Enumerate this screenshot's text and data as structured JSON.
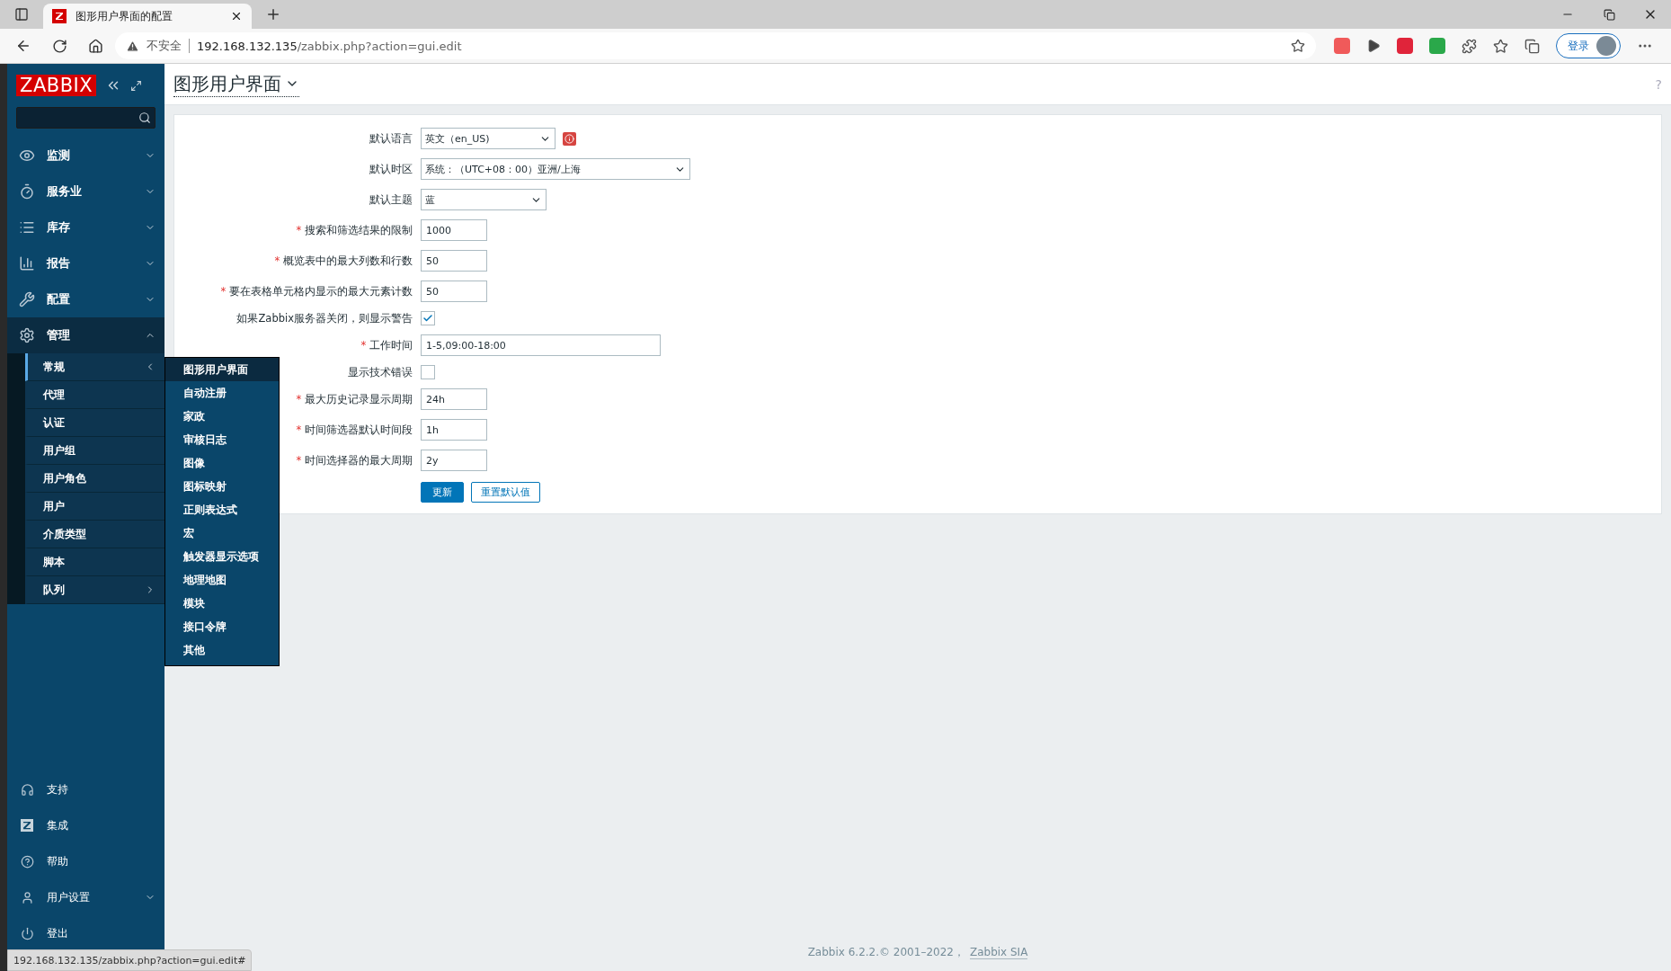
{
  "browser": {
    "tab_title": "图形用户界面的配置",
    "security": "不安全",
    "url_host": "192.168.132.135",
    "url_path": "/zabbix.php?action=gui.edit",
    "login": "登录"
  },
  "sidebar": {
    "logo": "ZABBIX",
    "items": [
      {
        "label": "监测",
        "expanded": false
      },
      {
        "label": "服务业",
        "expanded": false
      },
      {
        "label": "库存",
        "expanded": false
      },
      {
        "label": "报告",
        "expanded": false
      },
      {
        "label": "配置",
        "expanded": false
      },
      {
        "label": "管理",
        "expanded": true,
        "children": [
          {
            "label": "常规",
            "selected": true,
            "submenu": true
          },
          {
            "label": "代理",
            "selected": false,
            "submenu": false
          },
          {
            "label": "认证",
            "selected": false,
            "submenu": false
          },
          {
            "label": "用户组",
            "selected": false,
            "submenu": false
          },
          {
            "label": "用户角色",
            "selected": false,
            "submenu": false
          },
          {
            "label": "用户",
            "selected": false,
            "submenu": false
          },
          {
            "label": "介质类型",
            "selected": false,
            "submenu": false
          },
          {
            "label": "脚本",
            "selected": false,
            "submenu": false
          },
          {
            "label": "队列",
            "selected": false,
            "submenu": true
          }
        ]
      }
    ],
    "bottom_items": [
      {
        "label": "支持"
      },
      {
        "label": "集成"
      },
      {
        "label": "帮助"
      },
      {
        "label": "用户设置",
        "expanded": false
      },
      {
        "label": "登出"
      }
    ]
  },
  "flyout": [
    {
      "label": "图形用户界面",
      "selected": true
    },
    {
      "label": "自动注册",
      "selected": false
    },
    {
      "label": "家政",
      "selected": false
    },
    {
      "label": "审核日志",
      "selected": false
    },
    {
      "label": "图像",
      "selected": false
    },
    {
      "label": "图标映射",
      "selected": false
    },
    {
      "label": "正则表达式",
      "selected": false
    },
    {
      "label": "宏",
      "selected": false
    },
    {
      "label": "触发器显示选项",
      "selected": false
    },
    {
      "label": "地理地图",
      "selected": false
    },
    {
      "label": "模块",
      "selected": false
    },
    {
      "label": "接口令牌",
      "selected": false
    },
    {
      "label": "其他",
      "selected": false
    }
  ],
  "page": {
    "title": "图形用户界面",
    "help": "?"
  },
  "form": {
    "rows": [
      {
        "kind": "select",
        "label": "默认语言",
        "value": "英文（en_US)",
        "info": true
      },
      {
        "kind": "select",
        "label": "默认时区",
        "value": "系统：（UTC+08：00）亚洲/上海"
      },
      {
        "kind": "select",
        "label": "默认主题",
        "value": "蓝"
      },
      {
        "kind": "text",
        "label": "搜索和筛选结果的限制",
        "required_mark": "*",
        "value": "1000"
      },
      {
        "kind": "text",
        "label": "概览表中的最大列数和行数",
        "required_mark": "*",
        "value": "50"
      },
      {
        "kind": "text",
        "label": "要在表格单元格内显示的最大元素计数",
        "required_mark": "*",
        "value": "50"
      },
      {
        "kind": "checkbox",
        "label": "如果Zabbix服务器关闭，则显示警告",
        "checked": true
      },
      {
        "kind": "text",
        "label": "工作时间",
        "required_mark": "*",
        "value": "1-5,09:00-18:00",
        "wide": true
      },
      {
        "kind": "checkbox",
        "label": "显示技术错误",
        "checked": false
      },
      {
        "kind": "text",
        "label": "最大历史记录显示周期",
        "required_mark": "*",
        "value": "24h"
      },
      {
        "kind": "text",
        "label": "时间筛选器默认时间段",
        "required_mark": "*",
        "value": "1h"
      },
      {
        "kind": "text",
        "label": "时间选择器的最大周期",
        "required_mark": "*",
        "value": "2y"
      }
    ],
    "buttons": [
      {
        "label": "更新",
        "kind": "primary"
      },
      {
        "label": "重置默认值",
        "kind": "secondary"
      }
    ]
  },
  "footer": {
    "text": "Zabbix 6.2.2.© 2001–2022，",
    "link": "Zabbix SIA"
  },
  "status_bar": "192.168.132.135/zabbix.php?action=gui.edit#"
}
